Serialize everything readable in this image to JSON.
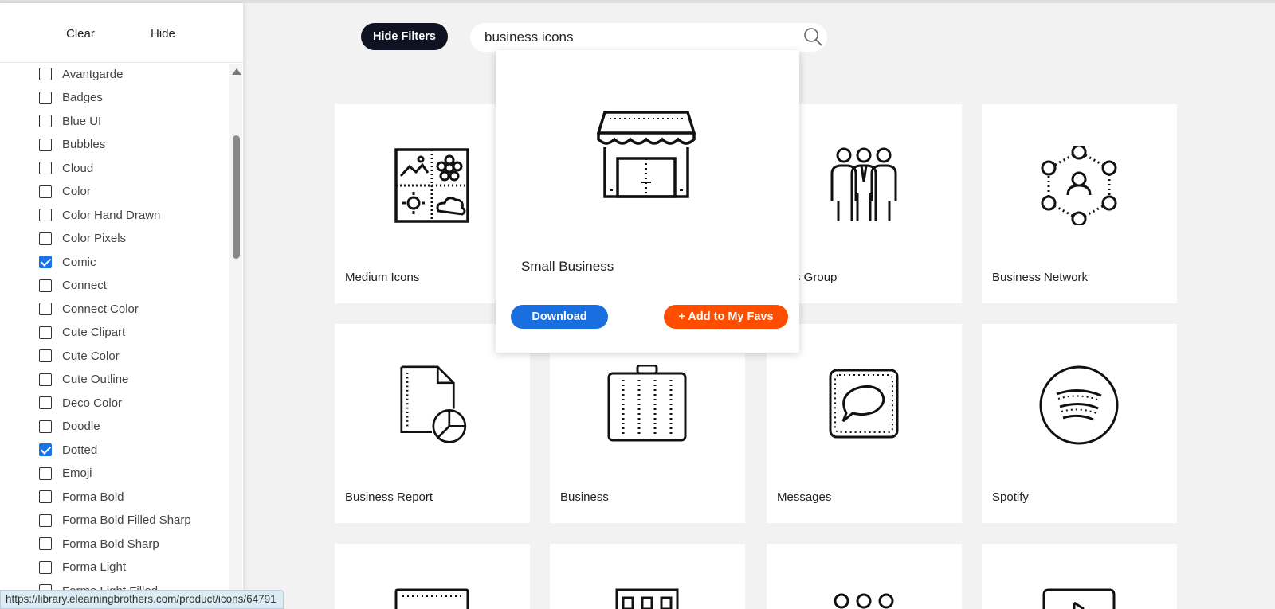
{
  "sidebar": {
    "clear_label": "Clear",
    "hide_label": "Hide",
    "filters": [
      {
        "label": "Avantgarde",
        "checked": false
      },
      {
        "label": "Badges",
        "checked": false
      },
      {
        "label": "Blue UI",
        "checked": false
      },
      {
        "label": "Bubbles",
        "checked": false
      },
      {
        "label": "Cloud",
        "checked": false
      },
      {
        "label": "Color",
        "checked": false
      },
      {
        "label": "Color Hand Drawn",
        "checked": false
      },
      {
        "label": "Color Pixels",
        "checked": false
      },
      {
        "label": "Comic",
        "checked": true
      },
      {
        "label": "Connect",
        "checked": false
      },
      {
        "label": "Connect Color",
        "checked": false
      },
      {
        "label": "Cute Clipart",
        "checked": false
      },
      {
        "label": "Cute Color",
        "checked": false
      },
      {
        "label": "Cute Outline",
        "checked": false
      },
      {
        "label": "Deco Color",
        "checked": false
      },
      {
        "label": "Doodle",
        "checked": false
      },
      {
        "label": "Dotted",
        "checked": true
      },
      {
        "label": "Emoji",
        "checked": false
      },
      {
        "label": "Forma Bold",
        "checked": false
      },
      {
        "label": "Forma Bold Filled Sharp",
        "checked": false
      },
      {
        "label": "Forma Bold Sharp",
        "checked": false
      },
      {
        "label": "Forma Light",
        "checked": false
      },
      {
        "label": "Forma Light Filled",
        "checked": false
      }
    ]
  },
  "toolbar": {
    "hide_filters_label": "Hide Filters",
    "search_value": "business icons"
  },
  "cards": [
    {
      "label": "Medium Icons",
      "icon": "seasons-icon"
    },
    {
      "label": "Small Business",
      "icon": "store-icon"
    },
    {
      "label": "Business Group",
      "icon": "business-group-icon",
      "visible_label": "siness Group"
    },
    {
      "label": "Business Network",
      "icon": "network-icon"
    },
    {
      "label": "Business Report",
      "icon": "report-icon"
    },
    {
      "label": "Business",
      "icon": "briefcase-icon"
    },
    {
      "label": "Messages",
      "icon": "messages-icon"
    },
    {
      "label": "Spotify",
      "icon": "spotify-icon"
    }
  ],
  "popup": {
    "title": "Small Business",
    "download_label": "Download",
    "fav_label": "+ Add to My Favs",
    "icon": "store-icon"
  },
  "status_url": "https://library.elearningbrothers.com/product/icons/64791",
  "colors": {
    "download": "#1a6fe0",
    "favs": "#ff4e00",
    "hide_filters": "#0f1220",
    "checkbox_checked": "#1a73e8"
  }
}
